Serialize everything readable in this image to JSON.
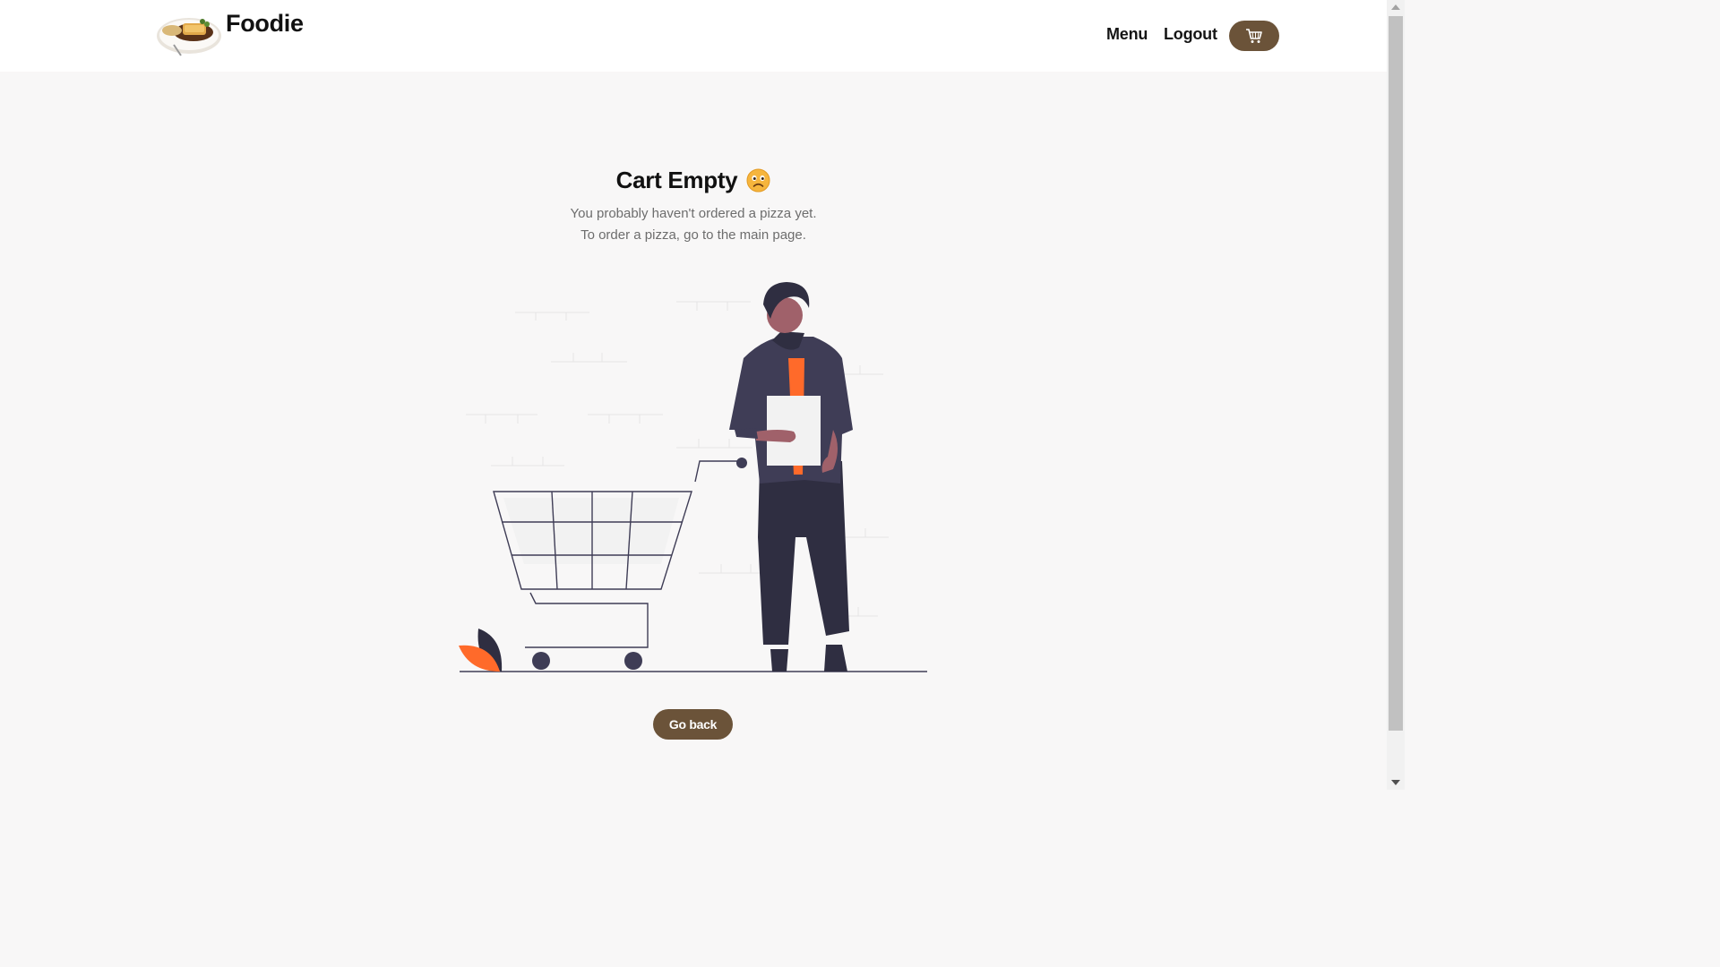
{
  "navbar": {
    "brand_name": "Foodie",
    "links": {
      "menu": "Menu",
      "logout": "Logout"
    },
    "cart_icon": "shopping-cart-icon"
  },
  "main": {
    "title": "Cart Empty",
    "title_emoji": "sad-face-emoji",
    "line1": "You probably haven't ordered a pizza yet.",
    "line2": "To order a pizza, go to the main page.",
    "illustration": "empty-cart-illustration",
    "go_back_label": "Go back"
  },
  "colors": {
    "accent": "#6b5339",
    "page_bg": "#f8f7f7",
    "navbar_bg": "#ffffff",
    "illustration_dark": "#3f3d56",
    "illustration_orange": "#ff6a2a",
    "skin": "#a0616a"
  }
}
